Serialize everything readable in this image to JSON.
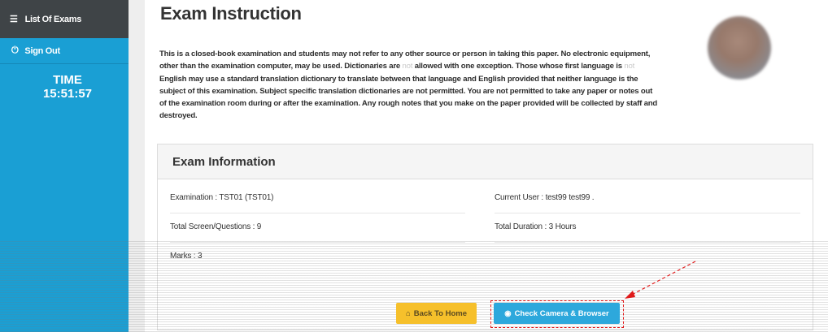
{
  "sidebar": {
    "items": [
      {
        "label": "List Of Exams",
        "icon": "menu-icon"
      },
      {
        "label": "Sign Out",
        "icon": "power-icon"
      }
    ],
    "timer": {
      "label": "TIME",
      "value": "15:51:57"
    }
  },
  "main": {
    "title": "Exam Instruction",
    "instructions": {
      "p1": "This is a closed-book examination and students may not refer to any other source or person in taking this paper. No electronic equipment, other than the examination computer, may be used. Dictionaries are ",
      "not1": "not",
      "p2": " allowed with one exception. Those whose first language is ",
      "not2": "not",
      "p3": " English may use a standard translation dictionary to translate between that language and English provided that neither language is the subject of this examination. Subject specific translation dictionaries are not permitted. You are not permitted to take any paper or notes out of the examination room during or after the examination. Any rough notes that you make on the paper provided will be collected by staff and destroyed."
    },
    "exam_info": {
      "heading": "Exam Information",
      "examination": "Examination : TST01 (TST01)",
      "current_user": "Current User : test99 test99 .",
      "total_questions": "Total Screen/Questions : 9",
      "total_duration": "Total Duration : 3 Hours",
      "marks": "Marks : 3"
    },
    "buttons": {
      "back_home": "Back To Home",
      "check_camera": "Check Camera & Browser"
    }
  },
  "colors": {
    "sidebar": "#1a9fd4",
    "sidebar_active": "#3f4447",
    "home_button": "#f6c02b",
    "check_button": "#2da8dc",
    "annotation": "#e01a1a"
  }
}
